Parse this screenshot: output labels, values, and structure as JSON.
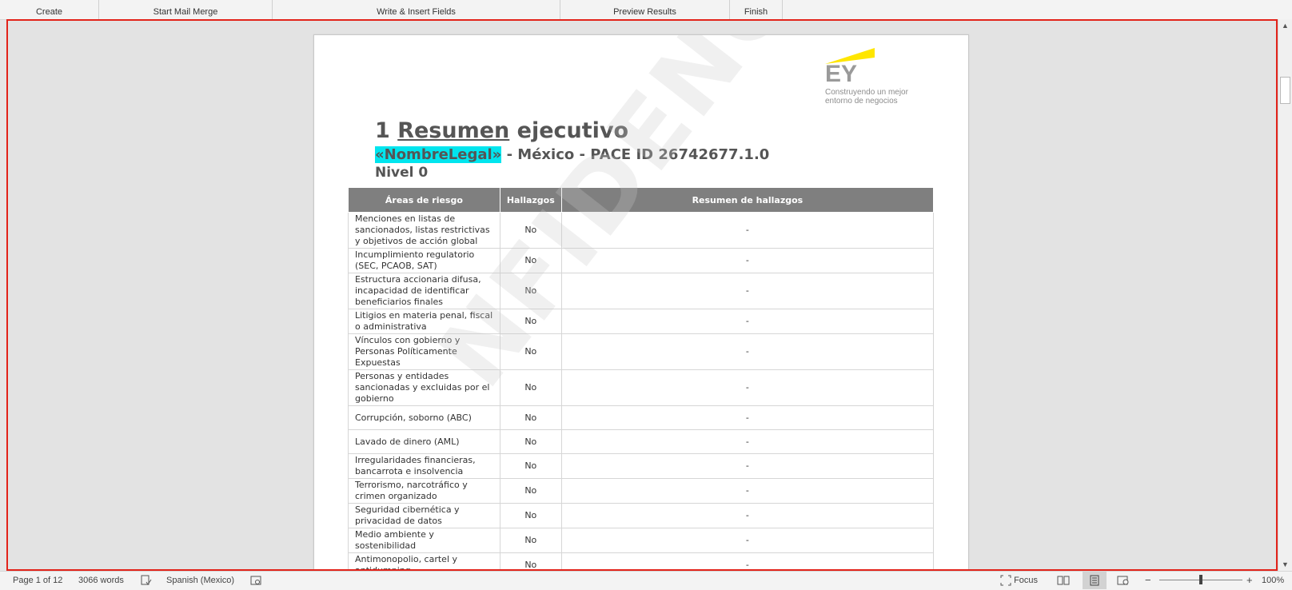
{
  "ribbon": {
    "groups": [
      "Create",
      "Start Mail Merge",
      "Write & Insert Fields",
      "Preview Results",
      "Finish"
    ]
  },
  "document": {
    "logo": {
      "mark": "EY",
      "tagline_1": "Construyendo un mejor",
      "tagline_2": "entorno de negocios",
      "accent_color": "#ffe600"
    },
    "heading_number": "1",
    "heading_word": "Resumen",
    "heading_rest": "ejecutivo",
    "merge_field": "«NombreLegal»",
    "subtitle_rest": " - México - PACE ID 26742677.1.0",
    "level": "Nivel 0",
    "watermark": "NFIDENCIAL",
    "table": {
      "headers": [
        "Áreas de riesgo",
        "Hallazgos",
        "Resumen de hallazgos"
      ],
      "rows": [
        {
          "area": "Menciones en listas de sancionados, listas restrictivas y objetivos de acción global",
          "hallazgo": "No",
          "resumen": "-"
        },
        {
          "area": "Incumplimiento regulatorio (SEC, PCAOB, SAT)",
          "hallazgo": "No",
          "resumen": "-"
        },
        {
          "area": "Estructura accionaria difusa, incapacidad de identificar beneficiarios finales",
          "hallazgo": "No",
          "resumen": "-"
        },
        {
          "area": "Litigios en materia penal, fiscal o administrativa",
          "hallazgo": "No",
          "resumen": "-"
        },
        {
          "area": "Vínculos con gobierno y Personas Políticamente Expuestas",
          "hallazgo": "No",
          "resumen": "-"
        },
        {
          "area": "Personas y entidades sancionadas y excluidas por el gobierno",
          "hallazgo": "No",
          "resumen": "-"
        },
        {
          "area": "Corrupción, soborno (ABC)",
          "hallazgo": "No",
          "resumen": "-"
        },
        {
          "area": "Lavado de dinero (AML)",
          "hallazgo": "No",
          "resumen": "-"
        },
        {
          "area": "Irregularidades financieras, bancarrota e insolvencia",
          "hallazgo": "No",
          "resumen": "-"
        },
        {
          "area": "Terrorismo, narcotráfico y crimen organizado",
          "hallazgo": "No",
          "resumen": "-"
        },
        {
          "area": "Seguridad cibernética y privacidad de datos",
          "hallazgo": "No",
          "resumen": "-"
        },
        {
          "area": "Medio ambiente y sostenibilidad",
          "hallazgo": "No",
          "resumen": "-"
        },
        {
          "area": "Antimonopolio, cartel y antidumping",
          "hallazgo": "No",
          "resumen": "-"
        }
      ]
    }
  },
  "statusbar": {
    "page": "Page 1 of 12",
    "words": "3066 words",
    "language": "Spanish (Mexico)",
    "focus": "Focus",
    "zoom": "100%",
    "zoom_minus": "−",
    "zoom_plus": "+"
  },
  "colors": {
    "selection_frame": "#e2231a",
    "table_header": "#7f7f7f",
    "field_highlight": "#00e5ee"
  }
}
